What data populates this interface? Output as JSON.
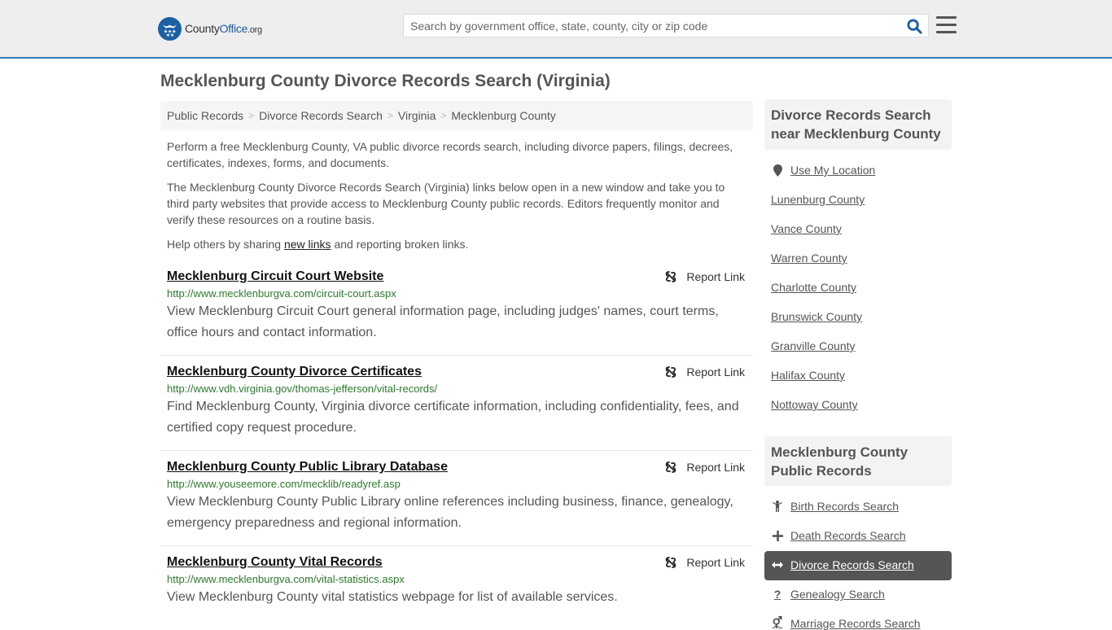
{
  "header": {
    "logo": {
      "part1": "County",
      "part2": "Office",
      "part3": ".org"
    },
    "search_placeholder": "Search by government office, state, county, city or zip code",
    "search_icon": "search-icon",
    "menu_icon": "hamburger-menu-icon",
    "accent_color": "#337ab7"
  },
  "page": {
    "title": "Mecklenburg County Divorce Records Search (Virginia)"
  },
  "breadcrumb": [
    {
      "label": "Public Records"
    },
    {
      "label": "Divorce Records Search"
    },
    {
      "label": "Virginia"
    },
    {
      "label": "Mecklenburg County"
    }
  ],
  "intro": {
    "p1": "Perform a free Mecklenburg County, VA public divorce records search, including divorce papers, filings, decrees, certificates, indexes, forms, and documents.",
    "p2": "The Mecklenburg County Divorce Records Search (Virginia) links below open in a new window and take you to third party websites that provide access to Mecklenburg County public records. Editors frequently monitor and verify these resources on a routine basis.",
    "p3_before": "Help others by sharing ",
    "p3_link": "new links",
    "p3_after": " and reporting broken links."
  },
  "listings": [
    {
      "title": "Mecklenburg Circuit Court Website",
      "url": "http://www.mecklenburgva.com/circuit-court.aspx",
      "description": "View Mecklenburg Circuit Court general information page, including judges' names, court terms, office hours and contact information.",
      "report_label": "Report Link"
    },
    {
      "title": "Mecklenburg County Divorce Certificates",
      "url": "http://www.vdh.virginia.gov/thomas-jefferson/vital-records/",
      "description": "Find Mecklenburg County, Virginia divorce certificate information, including confidentiality, fees, and certified copy request procedure.",
      "report_label": "Report Link"
    },
    {
      "title": "Mecklenburg County Public Library Database",
      "url": "http://www.youseemore.com/mecklib/readyref.asp",
      "description": "View Mecklenburg County Public Library online references including business, finance, genealogy, emergency preparedness and regional information.",
      "report_label": "Report Link"
    },
    {
      "title": "Mecklenburg County Vital Records",
      "url": "http://www.mecklenburgva.com/vital-statistics.aspx",
      "description": "View Mecklenburg County vital statistics webpage for list of available services.",
      "report_label": "Report Link"
    }
  ],
  "sidebar": {
    "nearby_heading": "Divorce Records Search near Mecklenburg County",
    "use_location": "Use My Location",
    "nearby": [
      "Lunenburg County",
      "Vance County",
      "Warren County",
      "Charlotte County",
      "Brunswick County",
      "Granville County",
      "Halifax County",
      "Nottoway County"
    ],
    "records_heading": "Mecklenburg County Public Records",
    "records": [
      {
        "label": "Birth Records Search",
        "icon": "child-icon",
        "active": false
      },
      {
        "label": "Death Records Search",
        "icon": "plus-icon",
        "active": false
      },
      {
        "label": "Divorce Records Search",
        "icon": "arrows-horizontal-icon",
        "active": true
      },
      {
        "label": "Genealogy Search",
        "icon": "question-icon",
        "active": false
      },
      {
        "label": "Marriage Records Search",
        "icon": "marriage-icon",
        "active": false
      }
    ]
  }
}
